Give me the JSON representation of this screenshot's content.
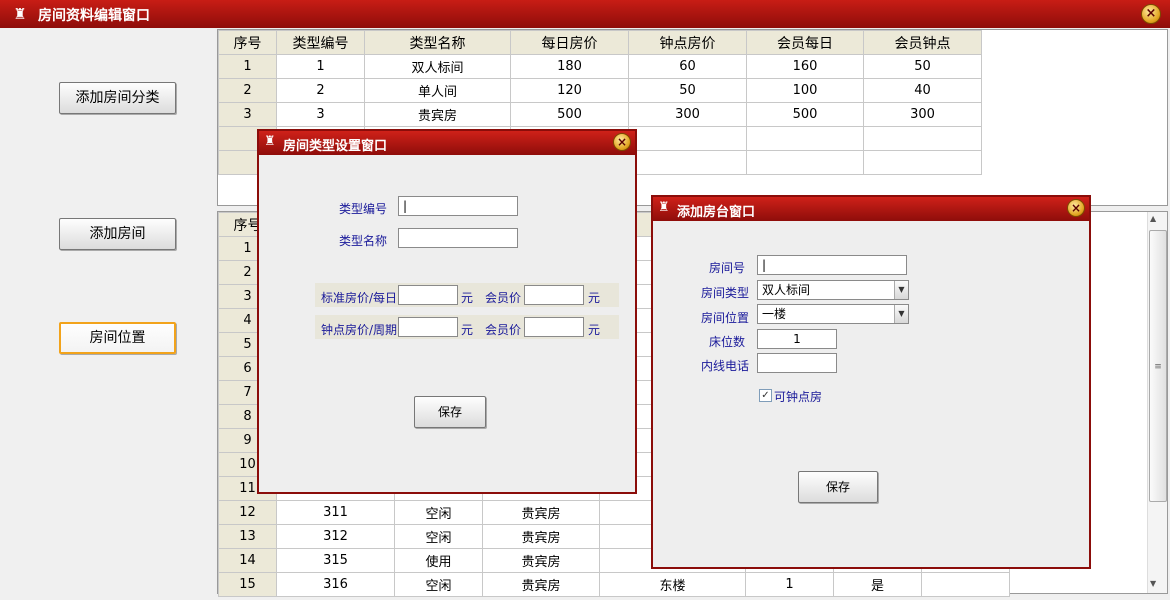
{
  "window": {
    "title": "房间资料编辑窗口",
    "close_glyph": "×"
  },
  "sidebar": {
    "add_category": "添加房间分类",
    "add_room": "添加房间",
    "room_location": "房间位置"
  },
  "type_table": {
    "headers": [
      "序号",
      "类型编号",
      "类型名称",
      "每日房价",
      "钟点房价",
      "会员每日",
      "会员钟点"
    ],
    "rows": [
      [
        "1",
        "1",
        "双人标间",
        "180",
        "60",
        "160",
        "50"
      ],
      [
        "2",
        "2",
        "单人间",
        "120",
        "50",
        "100",
        "40"
      ],
      [
        "3",
        "3",
        "贵宾房",
        "500",
        "300",
        "500",
        "300"
      ]
    ]
  },
  "room_table": {
    "header_idx": "序号",
    "index_only": [
      "1",
      "2",
      "3",
      "4",
      "5",
      "6",
      "7",
      "8",
      "9",
      "10",
      "11"
    ],
    "rows": [
      {
        "idx": "12",
        "room": "311",
        "status": "空闲",
        "type": "贵宾房",
        "loc": "",
        "beds": "",
        "hourly": ""
      },
      {
        "idx": "13",
        "room": "312",
        "status": "空闲",
        "type": "贵宾房",
        "loc": "",
        "beds": "",
        "hourly": ""
      },
      {
        "idx": "14",
        "room": "315",
        "status": "使用",
        "type": "贵宾房",
        "loc": "",
        "beds": "",
        "hourly": ""
      },
      {
        "idx": "15",
        "room": "316",
        "status": "空闲",
        "type": "贵宾房",
        "loc": "东楼",
        "beds": "1",
        "hourly": "是"
      }
    ]
  },
  "type_dialog": {
    "title": "房间类型设置窗口",
    "type_no_label": "类型编号",
    "type_name_label": "类型名称",
    "type_no_value": "|",
    "type_name_value": "",
    "std_price_label": "标准房价/每日",
    "hour_price_label": "钟点房价/周期",
    "member_price_label": "会员价",
    "unit": "元",
    "save": "保存"
  },
  "room_dialog": {
    "title": "添加房台窗口",
    "room_no_label": "房间号",
    "room_no_value": "|",
    "room_type_label": "房间类型",
    "room_type_value": "双人标间",
    "room_loc_label": "房间位置",
    "room_loc_value": "一楼",
    "beds_label": "床位数",
    "beds_value": "1",
    "phone_label": "内线电话",
    "phone_value": "",
    "hourly_label": "可钟点房",
    "hourly_checked": "✓",
    "save": "保存"
  },
  "scrollbar": {
    "up": "▲",
    "down": "▼",
    "grip": "≡"
  },
  "icons": {
    "app": "♜",
    "dropdown": "▼"
  },
  "colors": {
    "title_red": "#b5140f",
    "label_blue": "#1a1a9a"
  }
}
